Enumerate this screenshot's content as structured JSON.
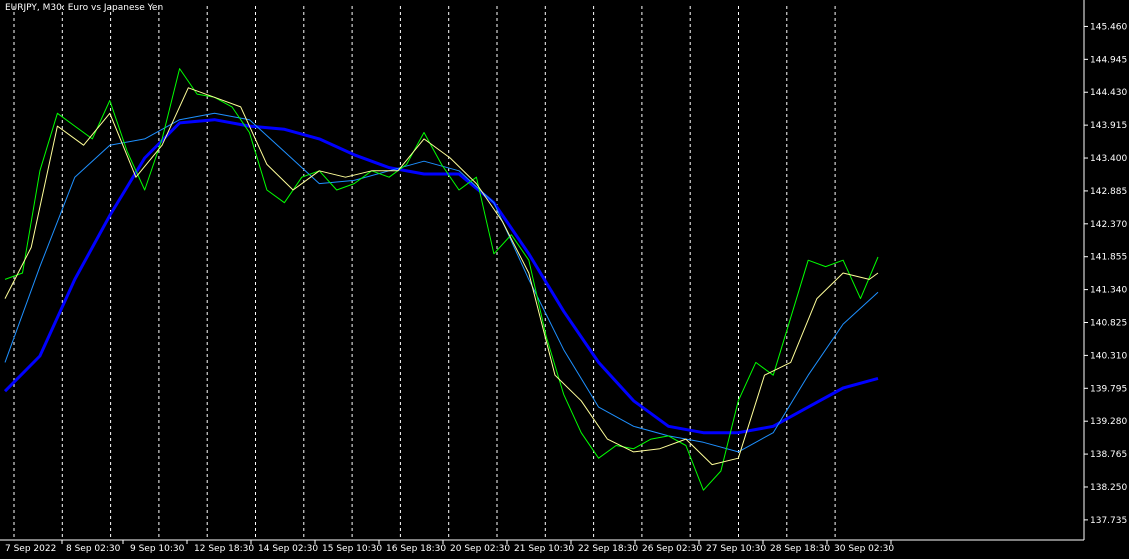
{
  "chart_data": {
    "type": "line",
    "title": "EURJPY, M30:  Euro vs Japanese Yen",
    "colors": {
      "background": "#000000",
      "axis": "#ffffff",
      "grid": "#ffffff",
      "price": "#00ff00",
      "ma_fast": "#ffff99",
      "ma_mid": "#1e90ff",
      "ma_slow": "#0000ff"
    },
    "grid": "vertical-dashed",
    "ylim": [
      137.42,
      145.78
    ],
    "xlim": [
      0,
      1
    ],
    "y_ticks": [
      "145.460",
      "144.945",
      "144.430",
      "143.915",
      "143.400",
      "142.885",
      "142.370",
      "141.855",
      "141.340",
      "140.825",
      "140.310",
      "139.795",
      "139.280",
      "138.765",
      "138.250",
      "137.735"
    ],
    "x_ticks": [
      {
        "label": "7 Sep 2022",
        "x": 0.0
      },
      {
        "label": "8 Sep 02:30",
        "x": 0.07
      },
      {
        "label": "9 Sep 10:30",
        "x": 0.18
      },
      {
        "label": "12 Sep 18:30",
        "x": 0.29
      },
      {
        "label": "14 Sep 02:30",
        "x": 0.4
      },
      {
        "label": "15 Sep 10:30",
        "x": 0.515
      },
      {
        "label": "16 Sep 18:30",
        "x": 0.625
      },
      {
        "label": "20 Sep 02:30",
        "x": 0.735
      },
      {
        "label": "21 Sep 10:30",
        "x": 0.845
      },
      {
        "label": "22 Sep 18:30",
        "x": 0.955
      },
      {
        "label": "26 Sep 02:30",
        "x": 1.065
      },
      {
        "label": "27 Sep 10:30",
        "x": 1.175
      },
      {
        "label": "28 Sep 18:30",
        "x": 1.285
      },
      {
        "label": "30 Sep 02:30",
        "x": 1.395
      }
    ],
    "series": [
      {
        "key": "price",
        "x": [
          0,
          0.02,
          0.04,
          0.06,
          0.08,
          0.1,
          0.12,
          0.14,
          0.16,
          0.18,
          0.2,
          0.22,
          0.24,
          0.26,
          0.28,
          0.3,
          0.32,
          0.34,
          0.36,
          0.38,
          0.4,
          0.42,
          0.44,
          0.46,
          0.48,
          0.5,
          0.52,
          0.54,
          0.56,
          0.58,
          0.6,
          0.62,
          0.64,
          0.66,
          0.68,
          0.7,
          0.72,
          0.74,
          0.76,
          0.78,
          0.8,
          0.82,
          0.84,
          0.86,
          0.88,
          0.9,
          0.92,
          0.94,
          0.96,
          0.98,
          1.0
        ],
        "y": [
          141.5,
          141.6,
          143.2,
          144.1,
          143.9,
          143.7,
          144.3,
          143.5,
          142.9,
          143.7,
          144.8,
          144.4,
          144.35,
          144.2,
          143.8,
          142.9,
          142.7,
          143.1,
          143.2,
          142.9,
          143.0,
          143.2,
          143.1,
          143.3,
          143.8,
          143.3,
          142.9,
          143.1,
          141.9,
          142.2,
          141.8,
          140.6,
          139.7,
          139.1,
          138.7,
          138.9,
          138.85,
          139.0,
          139.05,
          138.9,
          138.2,
          138.5,
          139.6,
          140.2,
          140.0,
          140.9,
          141.8,
          141.7,
          141.8,
          141.2,
          141.85
        ]
      },
      {
        "key": "ma_fast",
        "x": [
          0,
          0.03,
          0.06,
          0.09,
          0.12,
          0.15,
          0.18,
          0.21,
          0.24,
          0.27,
          0.3,
          0.33,
          0.36,
          0.39,
          0.42,
          0.45,
          0.48,
          0.51,
          0.54,
          0.57,
          0.6,
          0.63,
          0.66,
          0.69,
          0.72,
          0.75,
          0.78,
          0.81,
          0.84,
          0.87,
          0.9,
          0.93,
          0.96,
          0.99,
          1.0
        ],
        "y": [
          141.2,
          142.0,
          143.9,
          143.6,
          144.1,
          143.1,
          143.6,
          144.5,
          144.35,
          144.2,
          143.3,
          142.9,
          143.2,
          143.1,
          143.2,
          143.2,
          143.7,
          143.4,
          143.0,
          142.4,
          141.6,
          140.0,
          139.6,
          139.0,
          138.8,
          138.85,
          139.0,
          138.6,
          138.7,
          140.0,
          140.2,
          141.2,
          141.6,
          141.5,
          141.6
        ]
      },
      {
        "key": "ma_mid",
        "x": [
          0,
          0.04,
          0.08,
          0.12,
          0.16,
          0.2,
          0.24,
          0.28,
          0.32,
          0.36,
          0.4,
          0.44,
          0.48,
          0.52,
          0.56,
          0.6,
          0.64,
          0.68,
          0.72,
          0.76,
          0.8,
          0.84,
          0.88,
          0.92,
          0.96,
          1.0
        ],
        "y": [
          140.2,
          141.7,
          143.1,
          143.6,
          143.7,
          144.0,
          144.1,
          144.0,
          143.5,
          143.0,
          143.05,
          143.2,
          143.35,
          143.2,
          142.7,
          141.5,
          140.4,
          139.5,
          139.2,
          139.05,
          138.95,
          138.8,
          139.1,
          140.0,
          140.8,
          141.3
        ]
      },
      {
        "key": "ma_slow",
        "x": [
          0,
          0.04,
          0.08,
          0.12,
          0.16,
          0.2,
          0.24,
          0.28,
          0.32,
          0.36,
          0.4,
          0.44,
          0.48,
          0.52,
          0.56,
          0.6,
          0.64,
          0.68,
          0.72,
          0.76,
          0.8,
          0.84,
          0.88,
          0.92,
          0.96,
          1.0
        ],
        "y": [
          139.75,
          140.3,
          141.5,
          142.5,
          143.4,
          143.95,
          144.0,
          143.9,
          143.85,
          143.7,
          143.45,
          143.25,
          143.15,
          143.15,
          142.7,
          141.9,
          141.0,
          140.2,
          139.6,
          139.2,
          139.1,
          139.1,
          139.2,
          139.5,
          139.8,
          139.95
        ]
      }
    ]
  }
}
